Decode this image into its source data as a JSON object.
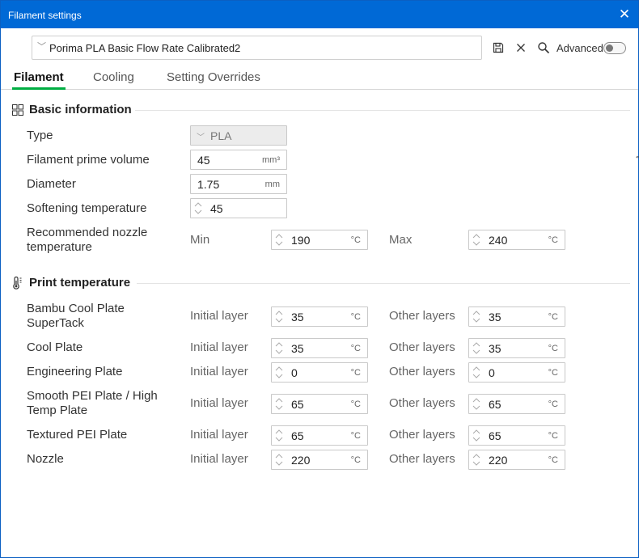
{
  "window": {
    "title": "Filament settings"
  },
  "preset": {
    "name": "Porima PLA Basic Flow Rate Calibrated2",
    "advanced_label": "Advanced",
    "advanced_on": false
  },
  "tabs": [
    {
      "label": "Filament",
      "active": true
    },
    {
      "label": "Cooling",
      "active": false
    },
    {
      "label": "Setting Overrides",
      "active": false
    }
  ],
  "basic": {
    "title": "Basic information",
    "type_label": "Type",
    "type_value": "PLA",
    "prime_label": "Filament prime volume",
    "prime_value": "45",
    "prime_unit": "mm³",
    "diameter_label": "Diameter",
    "diameter_value": "1.75",
    "diameter_unit": "mm",
    "soften_label": "Softening temperature",
    "soften_value": "45",
    "nozzle_label_1": "Recommended nozzle",
    "nozzle_label_2": "temperature",
    "min_label": "Min",
    "min_value": "190",
    "max_label": "Max",
    "max_value": "240",
    "unit_c": "°C"
  },
  "print": {
    "title": "Print temperature",
    "initial_label": "Initial layer",
    "other_label": "Other layers",
    "unit_c": "°C",
    "rows": [
      {
        "label1": "Bambu Cool Plate",
        "label2": "SuperTack",
        "initial": "35",
        "other": "35"
      },
      {
        "label1": "Cool Plate",
        "label2": "",
        "initial": "35",
        "other": "35"
      },
      {
        "label1": "Engineering Plate",
        "label2": "",
        "initial": "0",
        "other": "0"
      },
      {
        "label1": "Smooth PEI Plate / High",
        "label2": "Temp Plate",
        "initial": "65",
        "other": "65"
      },
      {
        "label1": "Textured PEI Plate",
        "label2": "",
        "initial": "65",
        "other": "65"
      },
      {
        "label1": "Nozzle",
        "label2": "",
        "initial": "220",
        "other": "220"
      }
    ]
  },
  "colors": {
    "titlebar": "#0069d6",
    "accent": "#00ae42"
  }
}
